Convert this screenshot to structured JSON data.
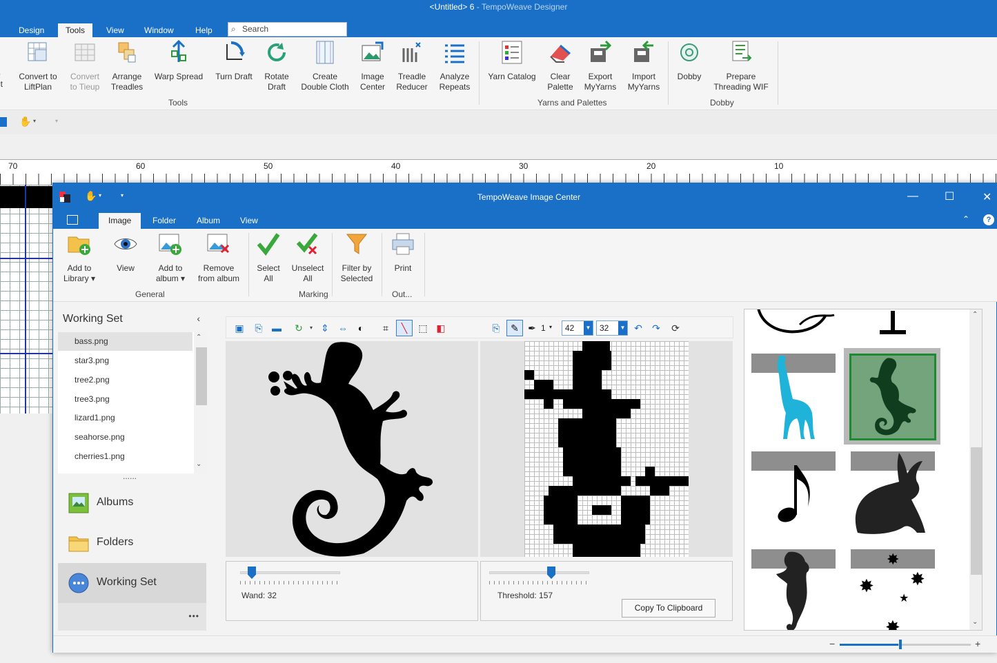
{
  "app": {
    "title": "<Untitled> 6",
    "app_name": " - TempoWeave Designer",
    "tabs": [
      "Design",
      "Tools",
      "View",
      "Window",
      "Help"
    ],
    "active_tab": "Tools",
    "search_placeholder": "Search"
  },
  "tools_ribbon": {
    "buttons": [
      {
        "label": "p\nrit"
      },
      {
        "label": "Convert to\nLiftPlan"
      },
      {
        "label": "Convert\nto Tieup"
      },
      {
        "label": "Arrange\nTreadles"
      },
      {
        "label": "Warp Spread"
      },
      {
        "label": "Turn Draft"
      },
      {
        "label": "Rotate\nDraft"
      },
      {
        "label": "Create\nDouble Cloth"
      },
      {
        "label": "Image\nCenter"
      },
      {
        "label": "Treadle\nReducer"
      },
      {
        "label": "Analyze\nRepeats"
      },
      {
        "label": "Yarn Catalog"
      },
      {
        "label": "Clear\nPalette"
      },
      {
        "label": "Export\nMyYarns"
      },
      {
        "label": "Import\nMyYarns"
      },
      {
        "label": "Dobby"
      },
      {
        "label": "Prepare\nThreading WIF"
      }
    ],
    "groups": [
      "Tools",
      "Yarns and Palettes",
      "Dobby"
    ]
  },
  "ruler": {
    "numbers": [
      "70",
      "60",
      "50",
      "40",
      "30",
      "20",
      "10"
    ]
  },
  "image_center": {
    "title": "TempoWeave Image Center",
    "tabs": [
      "Image",
      "Folder",
      "Album",
      "View"
    ],
    "active_tab": "Image",
    "ribbon": {
      "buttons": [
        {
          "label": "Add to\nLibrary ▾"
        },
        {
          "label": "View"
        },
        {
          "label": "Add to\nalbum ▾"
        },
        {
          "label": "Remove\nfrom album"
        },
        {
          "label": "Select\nAll"
        },
        {
          "label": "Unselect\nAll"
        },
        {
          "label": "Filter by\nSelected"
        },
        {
          "label": "Print"
        }
      ],
      "groups": [
        "General",
        "Marking",
        "Out..."
      ]
    },
    "sidebar": {
      "title": "Working Set",
      "files": [
        "bass.png",
        "star3.png",
        "tree2.png",
        "tree3.png",
        "lizard1.png",
        "seahorse.png",
        "cherries1.png"
      ],
      "selected_file": "bass.png",
      "more": "......",
      "nav": [
        "Albums",
        "Folders",
        "Working Set"
      ],
      "active_nav": "Working Set",
      "overflow": "•••"
    },
    "toolbar": {
      "pen_size": "1",
      "width": "42",
      "height": "32"
    },
    "wand": {
      "label": "Wand: 32",
      "value": 32
    },
    "threshold": {
      "label": "Threshold: 157",
      "value": 157
    },
    "copy_button": "Copy To Clipboard",
    "gallery": {
      "items": [
        "partial-top",
        "partial-top2",
        "giraffe",
        "lizard",
        "music-note",
        "rabbit",
        "seahorse",
        "stars"
      ],
      "selected": "lizard"
    },
    "zoom": {
      "minus": "−",
      "plus": "+"
    }
  },
  "colors": {
    "accent": "#1a6fc6",
    "giraffe": "#1fb3d9",
    "selection": "#1c8a2f"
  }
}
